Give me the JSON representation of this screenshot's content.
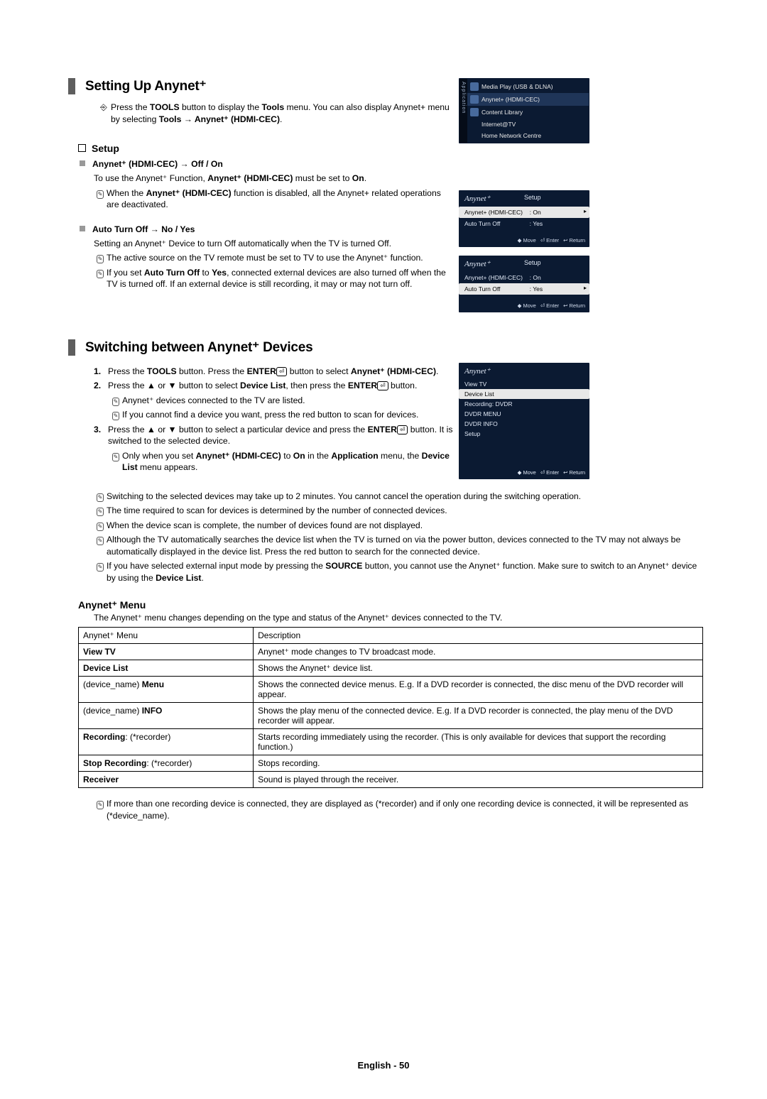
{
  "sections": {
    "a": {
      "heading": "Setting Up Anynet⁺",
      "tools_line": "Press the TOOLS button to display the Tools menu. You can also display Anynet+ menu by selecting Tools → Anynet⁺ (HDMI-CEC).",
      "setup_heading": "Setup",
      "item1_head": "Anynet⁺ (HDMI-CEC) → Off / On",
      "item1_line1": "To use the Anynet⁺ Function, Anynet⁺ (HDMI-CEC) must be set to On.",
      "item1_note": "When the Anynet⁺ (HDMI-CEC) function is disabled, all the Anynet+ related operations are deactivated.",
      "item2_head": "Auto Turn Off → No / Yes",
      "item2_line1": "Setting an Anynet⁺ Device to turn Off automatically when the TV is turned Off.",
      "item2_note1": "The active source on the TV remote must be set to TV to use the Anynet⁺ function.",
      "item2_note2": "If you set Auto Turn Off to Yes, connected external devices are also turned off when the TV is turned off. If an external device is still recording, it may or may not turn off."
    },
    "b": {
      "heading": "Switching between Anynet⁺ Devices",
      "n1": "Press the TOOLS button. Press the ENTER",
      "n1b": " button to select Anynet⁺ (HDMI-CEC).",
      "n2": "Press the ▲ or ▼ button to select Device List, then press the ENTER",
      "n2b": " button.",
      "n2_note1": "Anynet⁺ devices connected to the TV are listed.",
      "n2_note2": "If you cannot find a device you want, press the red button to scan for devices.",
      "n3": "Press the ▲ or ▼ button to select a particular device and press the ENTER",
      "n3b": " button. It is switched to the selected device.",
      "n3_note": "Only when you set Anynet⁺ (HDMI-CEC) to On in the Application menu, the Device List menu appears.",
      "p1": "Switching to the selected devices may take up to 2 minutes. You cannot cancel the operation during the switching operation.",
      "p2": "The time required to scan for devices is determined by the number of connected devices.",
      "p3": "When the device scan is complete, the number of devices found are not displayed.",
      "p4": "Although the TV automatically searches the device list when the TV is turned on via the power button, devices connected to the TV may not always be automatically displayed in the device list. Press the red button to search for the connected device.",
      "p5": "If you have selected external input mode by pressing the SOURCE button, you cannot use the Anynet⁺ function. Make sure to switch to an Anynet⁺ device by using the Device List."
    },
    "menu": {
      "heading": "Anynet⁺ Menu",
      "intro": "The Anynet⁺ menu changes depending on the type and status of the Anynet⁺ devices connected to the TV.",
      "col1": "Anynet⁺ Menu",
      "col2": "Description",
      "rows": [
        {
          "k": "View TV",
          "v": "Anynet⁺ mode changes to TV broadcast mode."
        },
        {
          "k": "Device List",
          "v": "Shows the Anynet⁺ device list."
        },
        {
          "k": "(device_name) Menu",
          "v": "Shows the connected device menus. E.g. If a DVD recorder is connected, the disc menu of the DVD recorder will appear."
        },
        {
          "k": "(device_name) INFO",
          "v": "Shows the play menu of the connected device. E.g. If a DVD recorder is connected, the play menu of the DVD recorder will appear."
        },
        {
          "k": "Recording: (*recorder)",
          "v": "Starts recording immediately using the recorder. (This is only available for devices that support the recording function.)"
        },
        {
          "k": "Stop Recording: (*recorder)",
          "v": "Stops recording."
        },
        {
          "k": "Receiver",
          "v": "Sound is played through the receiver."
        }
      ],
      "footnote": "If more than one recording device is connected, they are displayed as (*recorder) and if only one recording device is connected, it will be represented as (*device_name)."
    }
  },
  "osd": {
    "app": {
      "vtab": "Application",
      "items": [
        "Media Play (USB & DLNA)",
        "Anynet+ (HDMI-CEC)",
        "Content Library",
        "Internet@TV",
        "Home Network Centre"
      ]
    },
    "setup1": {
      "title": "Anynet⁺",
      "sub": "Setup",
      "r1k": "Anynet+ (HDMI-CEC)",
      "r1v": ": On",
      "r2k": "Auto Turn Off",
      "r2v": ": Yes",
      "f1": "◆ Move",
      "f2": "⏎ Enter",
      "f3": "↩ Return"
    },
    "setup2": {
      "title": "Anynet⁺",
      "sub": "Setup",
      "r1k": "Anynet+ (HDMI-CEC)",
      "r1v": ": On",
      "r2k": "Auto Turn Off",
      "r2v": ": Yes",
      "f1": "◆ Move",
      "f2": "⏎ Enter",
      "f3": "↩ Return"
    },
    "devlist": {
      "title": "Anynet⁺",
      "items": [
        "View TV",
        "Device List",
        "Recording: DVDR",
        "DVDR MENU",
        "DVDR INFO",
        "Setup"
      ],
      "f1": "◆ Move",
      "f2": "⏎ Enter",
      "f3": "↩ Return"
    }
  },
  "footer": "English - 50"
}
